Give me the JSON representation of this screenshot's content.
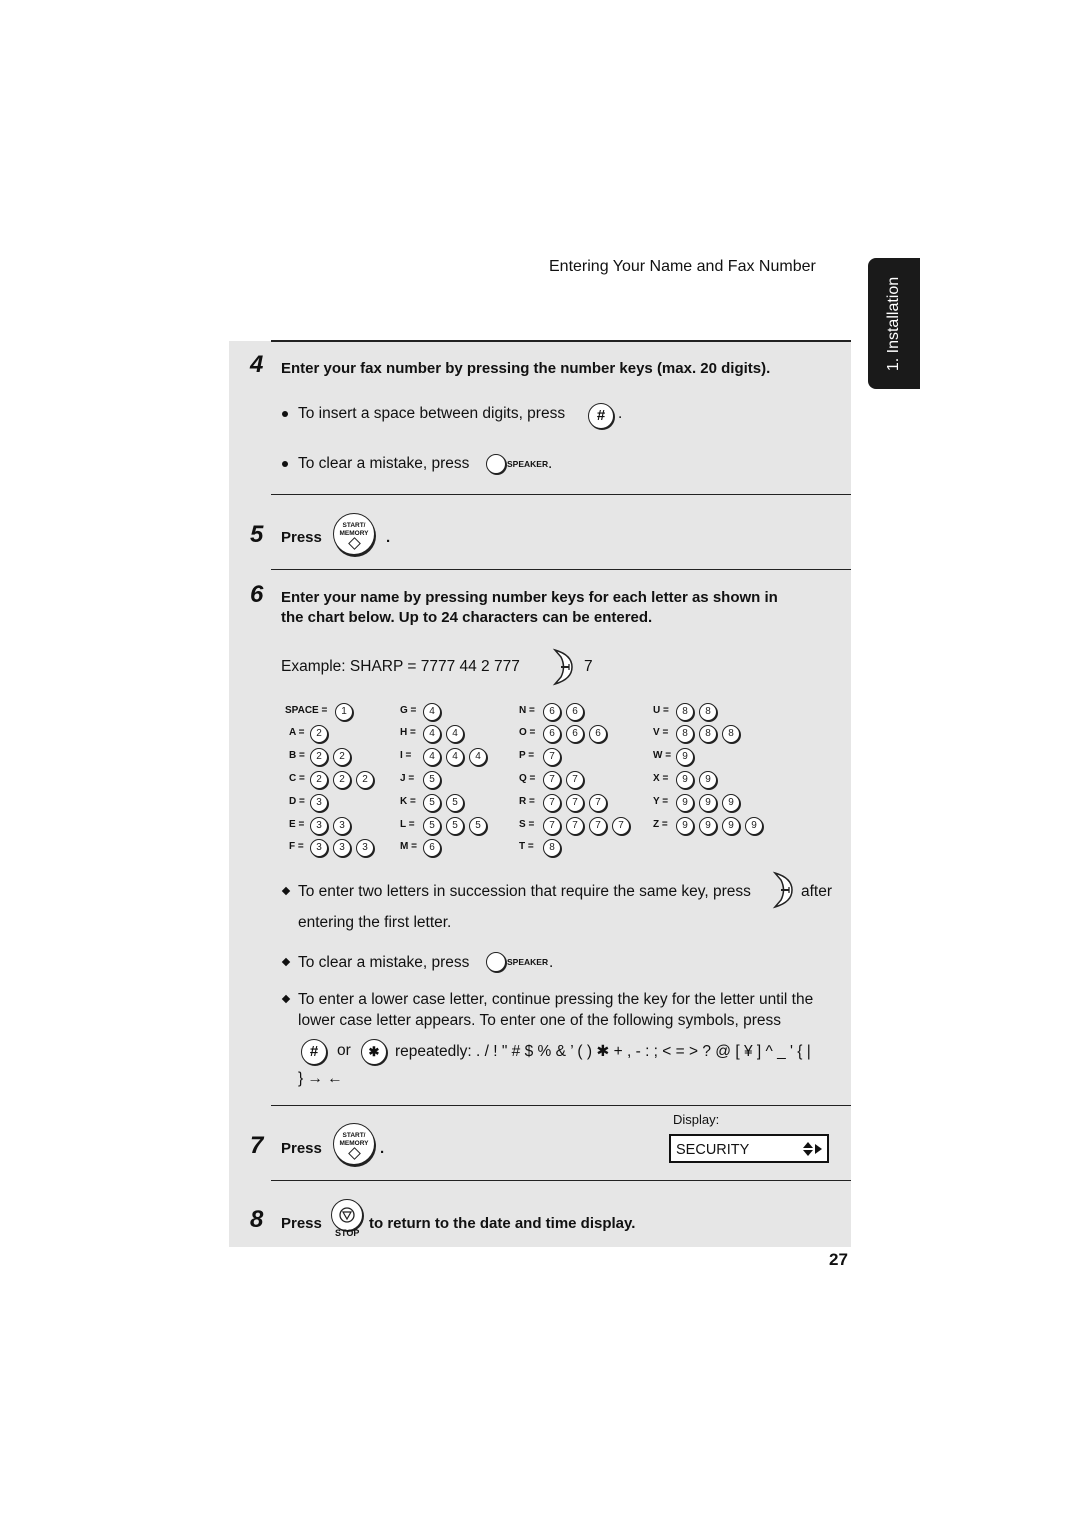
{
  "header": {
    "title": "Entering Your Name and Fax Number",
    "side_tab": "1. Installation"
  },
  "step4": {
    "number": "4",
    "heading": "Enter your fax number by pressing the number keys (max. 20 digits).",
    "bullet1_text": "To insert a space between digits, press",
    "bullet1_key_icon": "hash-key-icon",
    "bullet1_key": "#",
    "bullet2_text": "To clear a mistake, press",
    "bullet2_key_label": "SPEAKER",
    "period": "."
  },
  "step5": {
    "number": "5",
    "press": "Press",
    "key_line1": "START/",
    "key_line2": "MEMORY",
    "period": "."
  },
  "step6": {
    "number": "6",
    "heading_line1": "Enter your name by pressing number keys for each letter as shown in",
    "heading_line2": "the chart below. Up to 24 characters can be entered.",
    "example_text": "Example: SHARP = 7777  44  2  777",
    "example_tail": "7",
    "chart": [
      {
        "label": "SPACE =",
        "key": "1",
        "count": 1
      },
      {
        "label": "A =",
        "key": "2",
        "count": 1
      },
      {
        "label": "B =",
        "key": "2",
        "count": 2
      },
      {
        "label": "C =",
        "key": "2",
        "count": 3
      },
      {
        "label": "D =",
        "key": "3",
        "count": 1
      },
      {
        "label": "E =",
        "key": "3",
        "count": 2
      },
      {
        "label": "F =",
        "key": "3",
        "count": 3
      },
      {
        "label": "G =",
        "key": "4",
        "count": 1
      },
      {
        "label": "H =",
        "key": "4",
        "count": 2
      },
      {
        "label": "I =",
        "key": "4",
        "count": 3
      },
      {
        "label": "J =",
        "key": "5",
        "count": 1
      },
      {
        "label": "K =",
        "key": "5",
        "count": 2
      },
      {
        "label": "L =",
        "key": "5",
        "count": 3
      },
      {
        "label": "M =",
        "key": "6",
        "count": 1
      },
      {
        "label": "N =",
        "key": "6",
        "count": 2
      },
      {
        "label": "O =",
        "key": "6",
        "count": 3
      },
      {
        "label": "P =",
        "key": "7",
        "count": 1
      },
      {
        "label": "Q =",
        "key": "7",
        "count": 2
      },
      {
        "label": "R =",
        "key": "7",
        "count": 3
      },
      {
        "label": "S =",
        "key": "7",
        "count": 4
      },
      {
        "label": "T =",
        "key": "8",
        "count": 1
      },
      {
        "label": "U =",
        "key": "8",
        "count": 2
      },
      {
        "label": "V =",
        "key": "8",
        "count": 3
      },
      {
        "label": "W =",
        "key": "9",
        "count": 1
      },
      {
        "label": "X =",
        "key": "9",
        "count": 2
      },
      {
        "label": "Y =",
        "key": "9",
        "count": 3
      },
      {
        "label": "Z =",
        "key": "9",
        "count": 4
      }
    ],
    "note1_line1_a": "To enter two letters in succession that require the same key, press",
    "note1_line1_b": "after",
    "note1_line2": "entering the first letter.",
    "note2_text": "To clear a mistake, press",
    "note2_key_label": "SPEAKER",
    "note3_line1": "To enter a lower case letter, continue pressing the key for the letter until the",
    "note3_line2": "lower case letter appears. To enter one of the following symbols, press",
    "note3_key1": "#",
    "note3_or": "or",
    "note3_key2": "✱",
    "note3_symbols": "repeatedly: . / ! \" # $ % & ’ ( ) ✱ + , - : ; < = > ? @ [ ¥ ] ^ _ ' { |",
    "note3_line4": "} → ←",
    "period": "."
  },
  "step7": {
    "number": "7",
    "press": "Press",
    "key_line1": "START/",
    "key_line2": "MEMORY",
    "period": ".",
    "display_label": "Display:",
    "display_value": "SECURITY"
  },
  "step8": {
    "number": "8",
    "press": "Press",
    "key_label": "STOP",
    "text": "to return to the date and time display."
  },
  "page_number": "27"
}
